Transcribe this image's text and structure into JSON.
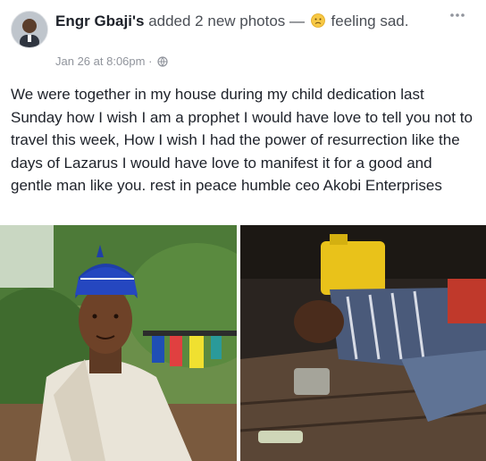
{
  "post": {
    "author": "Engr Gbaji's",
    "action": "added 2 new photos —",
    "feeling": "feeling sad.",
    "timestamp": "Jan 26 at 8:06pm ·",
    "privacy_icon": "globe-icon",
    "more_icon": "ellipsis-icon",
    "emoji_icon": "sad-face-icon",
    "text": "We were together in my house during my child dedication last Sunday how I wish I am a prophet I would have love to tell you not to travel this week, How I wish I had the power of resurrection like the days of Lazarus I would have love to manifest it for a good and gentle man like you. rest in peace humble ceo Akobi Enterprises"
  },
  "photos": [
    {
      "subject": "man-in-blue-cap-portrait"
    },
    {
      "subject": "accident-scene"
    }
  ],
  "colors": {
    "author": "#1d2129",
    "secondary_text": "#4b4f56",
    "meta": "#90949c"
  }
}
